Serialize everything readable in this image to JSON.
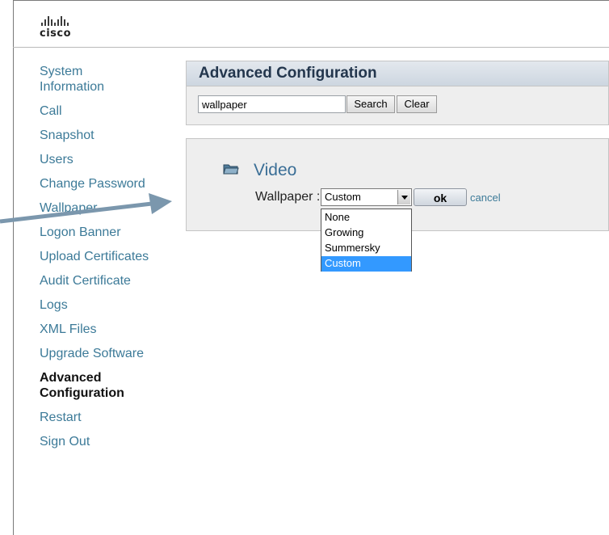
{
  "logo": {
    "text": "cisco"
  },
  "sidebar": {
    "items": [
      {
        "label": "System Information"
      },
      {
        "label": "Call"
      },
      {
        "label": "Snapshot"
      },
      {
        "label": "Users"
      },
      {
        "label": "Change Password"
      },
      {
        "label": "Wallpaper"
      },
      {
        "label": "Logon Banner"
      },
      {
        "label": "Upload Certificates"
      },
      {
        "label": "Audit Certificate"
      },
      {
        "label": "Logs"
      },
      {
        "label": "XML Files"
      },
      {
        "label": "Upgrade Software"
      },
      {
        "label": "Advanced Configuration",
        "active": true
      },
      {
        "label": "Restart"
      },
      {
        "label": "Sign Out"
      }
    ]
  },
  "config_panel": {
    "title": "Advanced Configuration",
    "search_value": "wallpaper",
    "search_label": "Search",
    "clear_label": "Clear"
  },
  "video_panel": {
    "title": "Video",
    "field_label": "Wallpaper :",
    "selected_value": "Custom",
    "options": [
      "None",
      "Growing",
      "Summersky",
      "Custom"
    ],
    "ok_label": "ok",
    "cancel_label": "cancel"
  },
  "colors": {
    "link": "#3c7a98",
    "header_text": "#23364d",
    "selection": "#3399ff",
    "callout_arrow": "#7b97ad"
  }
}
